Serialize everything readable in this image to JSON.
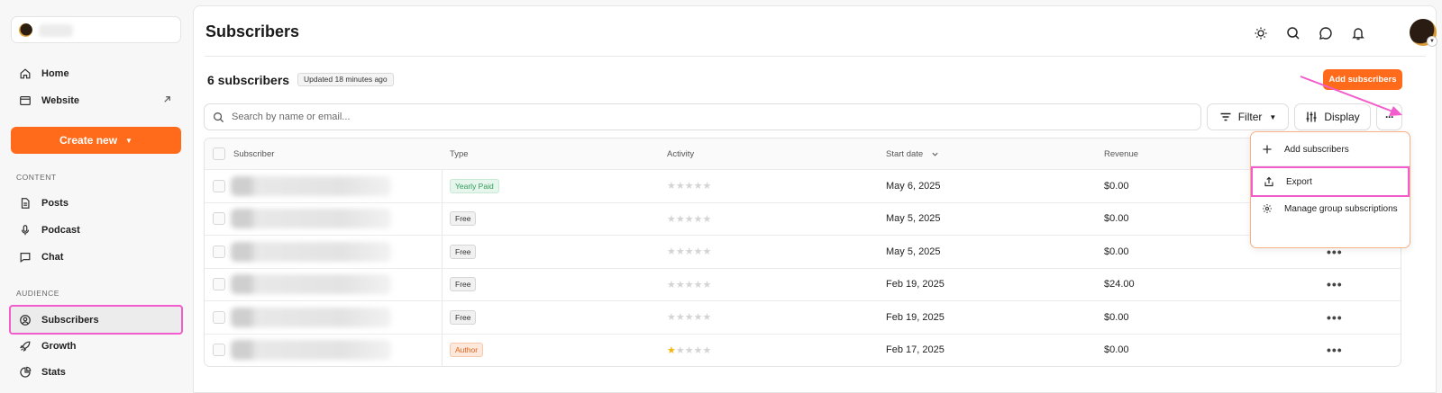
{
  "sidebar": {
    "nav_top": [
      {
        "label": "Home",
        "icon": "home-icon"
      },
      {
        "label": "Website",
        "icon": "website-icon"
      }
    ],
    "create_new": "Create new",
    "content_heading": "CONTENT",
    "content_items": [
      {
        "label": "Posts",
        "icon": "document-icon"
      },
      {
        "label": "Podcast",
        "icon": "microphone-icon"
      },
      {
        "label": "Chat",
        "icon": "chat-icon"
      }
    ],
    "audience_heading": "AUDIENCE",
    "audience_items": [
      {
        "label": "Subscribers",
        "icon": "user-circle-icon",
        "active": true
      },
      {
        "label": "Growth",
        "icon": "rocket-icon"
      },
      {
        "label": "Stats",
        "icon": "pie-chart-icon"
      }
    ]
  },
  "header": {
    "title": "Subscribers",
    "icons": [
      "sun-icon",
      "search-icon",
      "message-icon",
      "bell-icon"
    ]
  },
  "summary": {
    "count_text": "6 subscribers",
    "updated_text": "Updated 18 minutes ago",
    "add_button": "Add subscribers"
  },
  "toolbar": {
    "search_placeholder": "Search by name or email...",
    "filter_label": "Filter",
    "display_label": "Display",
    "more_label": "···"
  },
  "table": {
    "columns": [
      "Subscriber",
      "Type",
      "Activity",
      "Start date",
      "Revenue"
    ],
    "rows": [
      {
        "type": "Yearly Paid",
        "type_style": "paid",
        "activity_stars": 0,
        "start_date": "May 6, 2025",
        "revenue": "$0.00"
      },
      {
        "type": "Free",
        "type_style": "free",
        "activity_stars": 0,
        "start_date": "May 5, 2025",
        "revenue": "$0.00"
      },
      {
        "type": "Free",
        "type_style": "free",
        "activity_stars": 0,
        "start_date": "May 5, 2025",
        "revenue": "$0.00"
      },
      {
        "type": "Free",
        "type_style": "free",
        "activity_stars": 0,
        "start_date": "Feb 19, 2025",
        "revenue": "$24.00"
      },
      {
        "type": "Free",
        "type_style": "free",
        "activity_stars": 0,
        "start_date": "Feb 19, 2025",
        "revenue": "$0.00"
      },
      {
        "type": "Author",
        "type_style": "author",
        "activity_stars": 1,
        "start_date": "Feb 17, 2025",
        "revenue": "$0.00"
      }
    ],
    "row_more": "•••"
  },
  "menu": {
    "items": [
      {
        "label": "Add subscribers",
        "icon": "plus-icon"
      },
      {
        "label": "Export",
        "icon": "upload-icon",
        "highlighted": true
      },
      {
        "label": "Manage group subscriptions",
        "icon": "gear-icon"
      }
    ]
  },
  "colors": {
    "accent": "#ff6b1a",
    "annotation": "#f25ccc",
    "paid_badge": "#2e9b58",
    "author_badge": "#e0651e"
  }
}
